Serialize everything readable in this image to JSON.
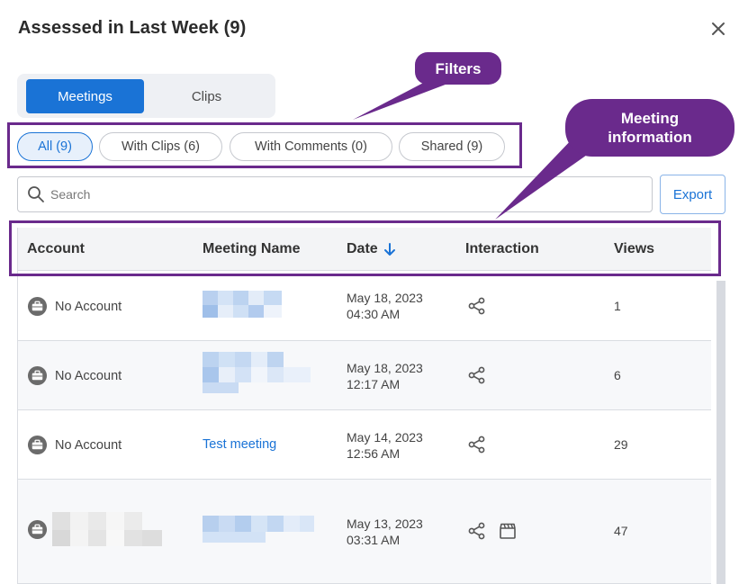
{
  "dialog": {
    "title": "Assessed in Last Week (9)"
  },
  "tabs": [
    {
      "label": "Meetings",
      "active": true
    },
    {
      "label": "Clips",
      "active": false
    }
  ],
  "filters": [
    {
      "label": "All (9)",
      "active": true
    },
    {
      "label": "With Clips (6)",
      "active": false
    },
    {
      "label": "With Comments (0)",
      "active": false
    },
    {
      "label": "Shared (9)",
      "active": false
    }
  ],
  "search": {
    "placeholder": "Search",
    "value": ""
  },
  "export_label": "Export",
  "table": {
    "columns": [
      "Account",
      "Meeting Name",
      "Date",
      "Interaction",
      "Views"
    ],
    "sort": {
      "column": "Date",
      "direction": "desc"
    },
    "rows": [
      {
        "account": "No Account",
        "meeting": "",
        "date_line1": "May 18, 2023",
        "date_line2": "04:30 AM",
        "interactions": [
          "share-icon"
        ],
        "views": "1"
      },
      {
        "account": "No Account",
        "meeting": "",
        "date_line1": "May 18, 2023",
        "date_line2": "12:17 AM",
        "interactions": [
          "share-icon"
        ],
        "views": "6"
      },
      {
        "account": "No Account",
        "meeting": "Test meeting",
        "date_line1": "May 14, 2023",
        "date_line2": "12:56 AM",
        "interactions": [
          "share-icon"
        ],
        "views": "29"
      },
      {
        "account": "",
        "meeting": "",
        "date_line1": "May 13, 2023",
        "date_line2": "03:31 AM",
        "interactions": [
          "share-icon",
          "clapperboard-icon"
        ],
        "views": "47"
      }
    ]
  },
  "annotations": {
    "filters": "Filters",
    "meeting_info_line1": "Meeting",
    "meeting_info_line2": "information"
  },
  "colors": {
    "primary": "#1a73d6",
    "annotation": "#6a2a8c"
  }
}
